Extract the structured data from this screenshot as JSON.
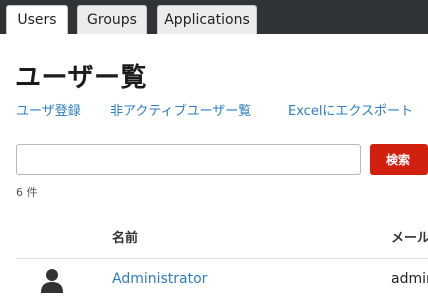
{
  "tabs": [
    {
      "label": "Users",
      "active": true
    },
    {
      "label": "Groups",
      "active": false
    },
    {
      "label": "Applications",
      "active": false
    }
  ],
  "page_title": "ユーザー覧",
  "actions": {
    "register": "ユーザ登録",
    "inactive_users": "非アクティブユーザー覧",
    "export_excel": "Excelにエクスポート"
  },
  "search": {
    "value": "",
    "placeholder": "",
    "button_label": "検索"
  },
  "result_count": "6 件",
  "table": {
    "columns": [
      "名前",
      "メール"
    ],
    "rows": [
      {
        "icon": "user-icon",
        "name": "Administrator",
        "email": "admin"
      }
    ]
  },
  "colors": {
    "tabbar_bg": "#313437",
    "link": "#2e7dc2",
    "search_button": "#d2200f"
  }
}
